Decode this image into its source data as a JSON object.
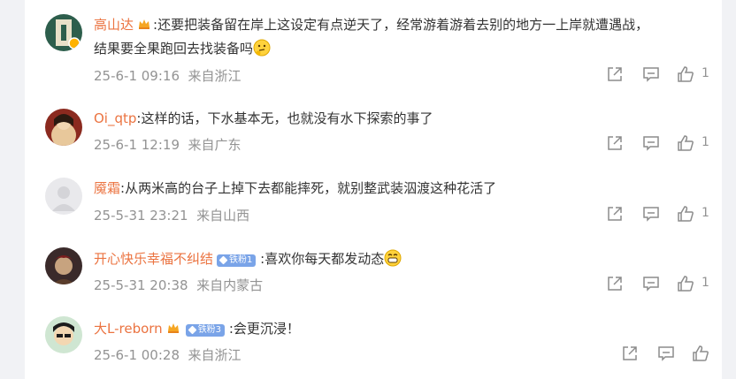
{
  "comments": [
    {
      "username": "高山达",
      "text1": ":还要把装备留在岸上这设定有点逆天了，经常游着游着去别的地方一上岸就遭遇战，",
      "text2": "结果要全果跑回去找装备吗",
      "emoji": "thinking-face",
      "date": "25-6-1 09:16",
      "location": "来自浙江",
      "likes": "1"
    },
    {
      "username": "Oi_qtp",
      "text1": ":这样的话，下水基本无，也就没有水下探索的事了",
      "date": "25-6-1 12:19",
      "location": "来自广东",
      "likes": "1"
    },
    {
      "username": "魇霜",
      "text1": ":从两米高的台子上掉下去都能摔死，就别整武装泅渡这种花活了",
      "date": "25-5-31 23:21",
      "location": "来自山西",
      "likes": "1"
    },
    {
      "username": "开心快乐幸福不纠结",
      "badge": "铁粉1",
      "text1": ":喜欢你每天都发动态",
      "emoji": "grinning-face",
      "date": "25-5-31 20:38",
      "location": "来自内蒙古",
      "likes": "1"
    },
    {
      "username": "大L-reborn",
      "badge": "铁粉3",
      "text1": ":会更沉浸！",
      "date": "25-6-1 00:28",
      "location": "来自浙江",
      "likes": ""
    }
  ],
  "colors": {
    "username": "#eb7340",
    "meta": "#939393",
    "badge": "#7aa4e8",
    "background": "#f1f2f5"
  },
  "icons": [
    "share-icon",
    "comment-icon",
    "like-icon",
    "crown-icon",
    "verified-icon"
  ]
}
